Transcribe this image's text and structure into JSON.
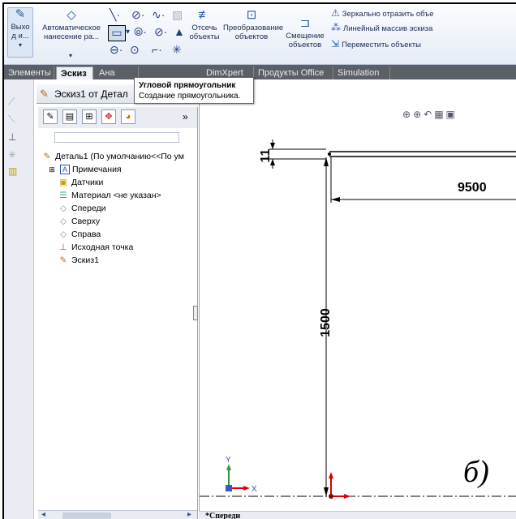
{
  "ribbon": {
    "exit_label": "Выхо\nд и...",
    "auto_dim_label": "Автоматическое нанесение ра...",
    "trim_label": "Отсечь объекты",
    "convert_label": "Преобразование объектов",
    "offset_label": "Смещение объектов",
    "mirror_label": "Зеркально отразить объе",
    "linear_pattern_label": "Линейный массив эскиза",
    "move_label": "Переместить объекты"
  },
  "tabs": [
    {
      "label": "Элементы"
    },
    {
      "label": "Эскиз"
    },
    {
      "label": "Ана"
    },
    {
      "label": "DimXpert"
    },
    {
      "label": "Продукты Office"
    },
    {
      "label": "Simulation"
    }
  ],
  "tooltip": {
    "title": "Угловой прямоугольник",
    "desc": "Создание прямоугольника."
  },
  "doc": {
    "title": "Эскиз1 от Детал"
  },
  "panel": {
    "tabs_more": "»",
    "tree": [
      {
        "label": "Деталь1  (По умолчанию<<По ум",
        "icon": "part-icon"
      },
      {
        "label": "Примечания",
        "icon": "annotations-icon"
      },
      {
        "label": "Датчики",
        "icon": "sensors-icon"
      },
      {
        "label": "Материал <не указан>",
        "icon": "material-icon"
      },
      {
        "label": "Спереди",
        "icon": "plane-icon"
      },
      {
        "label": "Сверху",
        "icon": "plane-icon"
      },
      {
        "label": "Справа",
        "icon": "plane-icon"
      },
      {
        "label": "Исходная точка",
        "icon": "origin-icon"
      },
      {
        "label": "Эскиз1",
        "icon": "sketch-icon"
      }
    ]
  },
  "canvas": {
    "dim_top": "11",
    "dim_horizontal": "9500",
    "dim_vertical": "1500",
    "label_b": "б)",
    "axis_y": "Y",
    "axis_x": "X"
  },
  "status": {
    "view_name": "*Спереди"
  },
  "colors": {
    "tab_bar": "#5b5f66",
    "ribbon_icon": "#2a58a8"
  }
}
